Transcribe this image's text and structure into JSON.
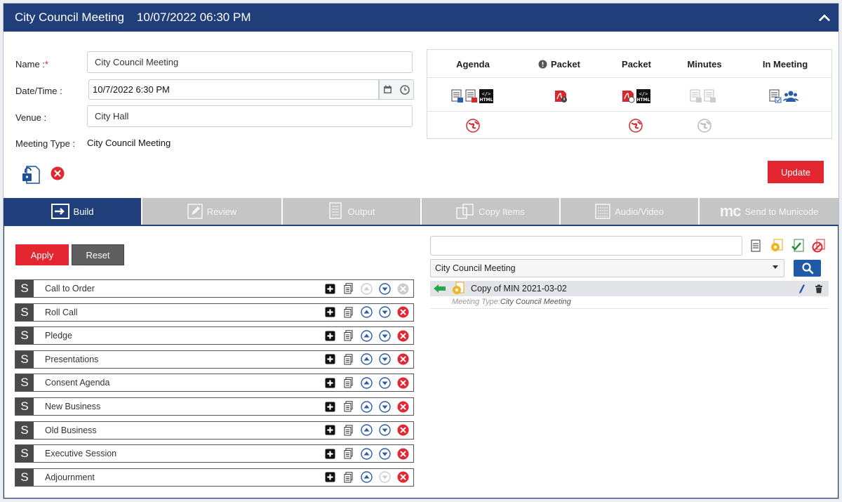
{
  "header": {
    "title": "City Council Meeting",
    "datetime": "10/07/2022 06:30 PM"
  },
  "form": {
    "name_label": "Name :",
    "name_required_mark": "*",
    "name_value": "City Council Meeting",
    "datetime_label": "Date/Time :",
    "datetime_value": "10/7/2022 6:30 PM",
    "venue_label": "Venue :",
    "venue_value": "City Hall",
    "meeting_type_label": "Meeting Type :",
    "meeting_type_value": "City Council Meeting"
  },
  "outputs": {
    "columns": [
      "Agenda",
      "Packet",
      "Packet",
      "Minutes",
      "In Meeting"
    ],
    "html_badge": "HTML"
  },
  "buttons": {
    "update": "Update",
    "apply": "Apply",
    "reset": "Reset"
  },
  "tabs": [
    {
      "label": "Build",
      "icon": "build-icon",
      "active": true
    },
    {
      "label": "Review",
      "icon": "pencil-icon",
      "active": false
    },
    {
      "label": "Output",
      "icon": "output-icon",
      "active": false
    },
    {
      "label": "Copy Items",
      "icon": "copy-icon",
      "active": false
    },
    {
      "label": "Audio/Video",
      "icon": "av-icon",
      "active": false
    },
    {
      "label": "Send to Municode",
      "icon": "mc-logo",
      "active": false
    }
  ],
  "mc_logo_text": "mc",
  "sections": [
    {
      "badge": "S",
      "name": "Call to Order"
    },
    {
      "badge": "S",
      "name": "Roll Call"
    },
    {
      "badge": "S",
      "name": "Pledge"
    },
    {
      "badge": "S",
      "name": "Presentations"
    },
    {
      "badge": "S",
      "name": "Consent Agenda"
    },
    {
      "badge": "S",
      "name": "New Business"
    },
    {
      "badge": "S",
      "name": "Old Business"
    },
    {
      "badge": "S",
      "name": "Executive Session"
    },
    {
      "badge": "S",
      "name": "Adjournment"
    }
  ],
  "right_panel": {
    "search_value": "",
    "select_value": "City Council Meeting",
    "result": {
      "title": "Copy of MIN 2021-03-02",
      "meta_label": "Meeting Type:",
      "meta_value": "City Council Meeting"
    }
  },
  "colors": {
    "brand": "#1f3e7a",
    "accent_red": "#e3262f",
    "tab_inactive": "#c5c5c5"
  }
}
